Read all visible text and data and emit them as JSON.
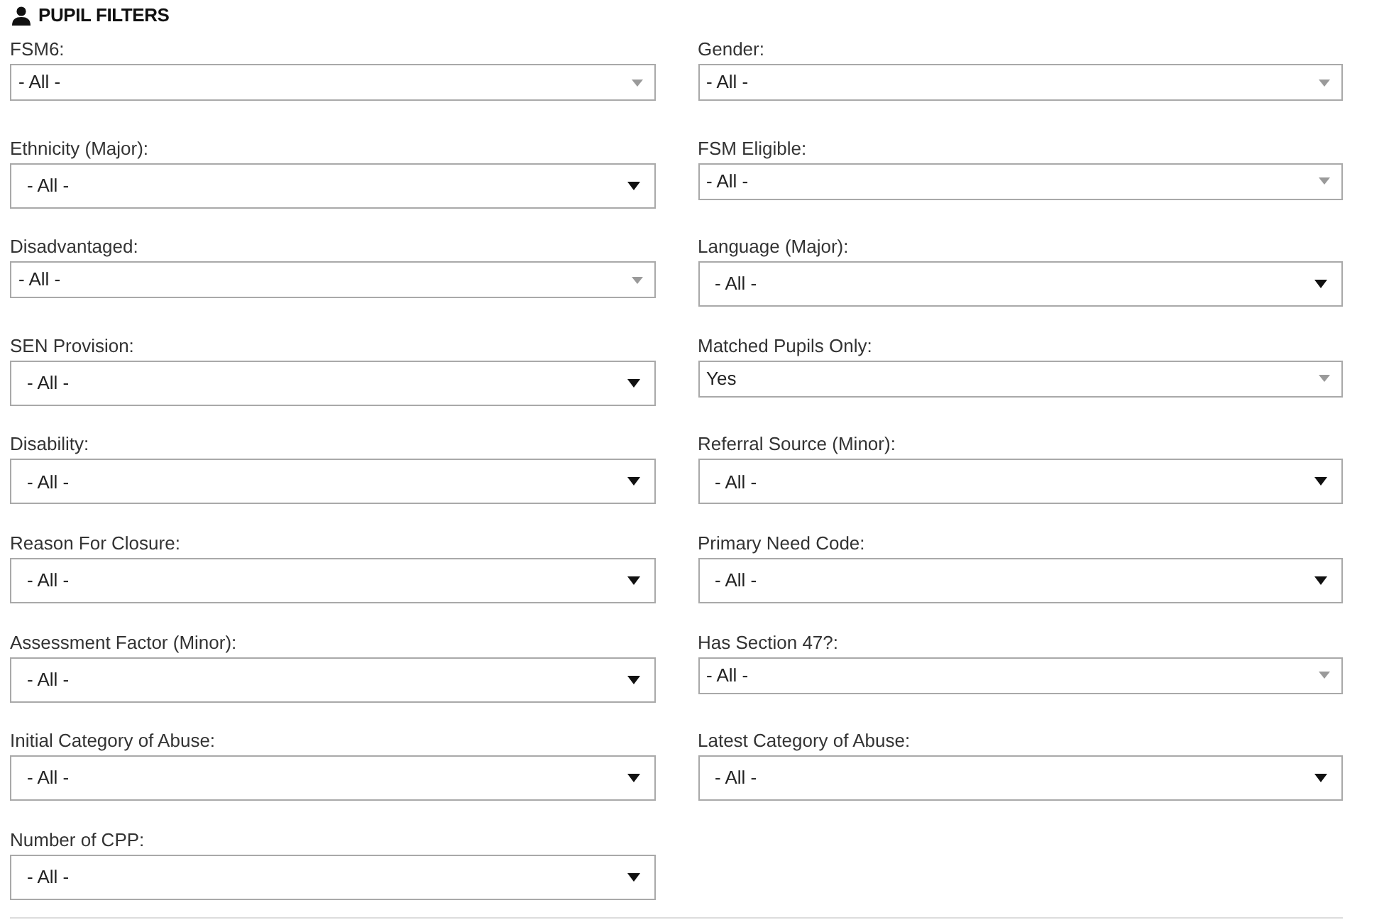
{
  "section": {
    "title": "PUPIL FILTERS"
  },
  "filters": [
    {
      "label": "FSM6:",
      "kind": "basic",
      "value": "- All -"
    },
    {
      "label": "Gender:",
      "kind": "basic",
      "value": "- All -"
    },
    {
      "label": "Ethnicity (Major):",
      "kind": "styled",
      "value": "- All -"
    },
    {
      "label": "FSM Eligible:",
      "kind": "basic",
      "value": "- All -"
    },
    {
      "label": "Disadvantaged:",
      "kind": "basic",
      "value": "- All -"
    },
    {
      "label": "Language (Major):",
      "kind": "styled",
      "value": "- All -"
    },
    {
      "label": "SEN Provision:",
      "kind": "styled",
      "value": "- All -"
    },
    {
      "label": "Matched Pupils Only:",
      "kind": "basic",
      "value": "Yes"
    },
    {
      "label": "Disability:",
      "kind": "styled",
      "value": "- All -"
    },
    {
      "label": "Referral Source (Minor):",
      "kind": "styled",
      "value": "- All -"
    },
    {
      "label": "Reason For Closure:",
      "kind": "styled",
      "value": "- All -"
    },
    {
      "label": "Primary Need Code:",
      "kind": "styled",
      "value": "- All -"
    },
    {
      "label": "Assessment Factor (Minor):",
      "kind": "styled",
      "value": "- All -"
    },
    {
      "label": "Has Section 47?:",
      "kind": "basic",
      "value": "- All -"
    },
    {
      "label": "Initial Category of Abuse:",
      "kind": "styled",
      "value": "- All -"
    },
    {
      "label": "Latest Category of Abuse:",
      "kind": "styled",
      "value": "- All -"
    },
    {
      "label": "Number of CPP:",
      "kind": "styled",
      "value": "- All -"
    }
  ]
}
